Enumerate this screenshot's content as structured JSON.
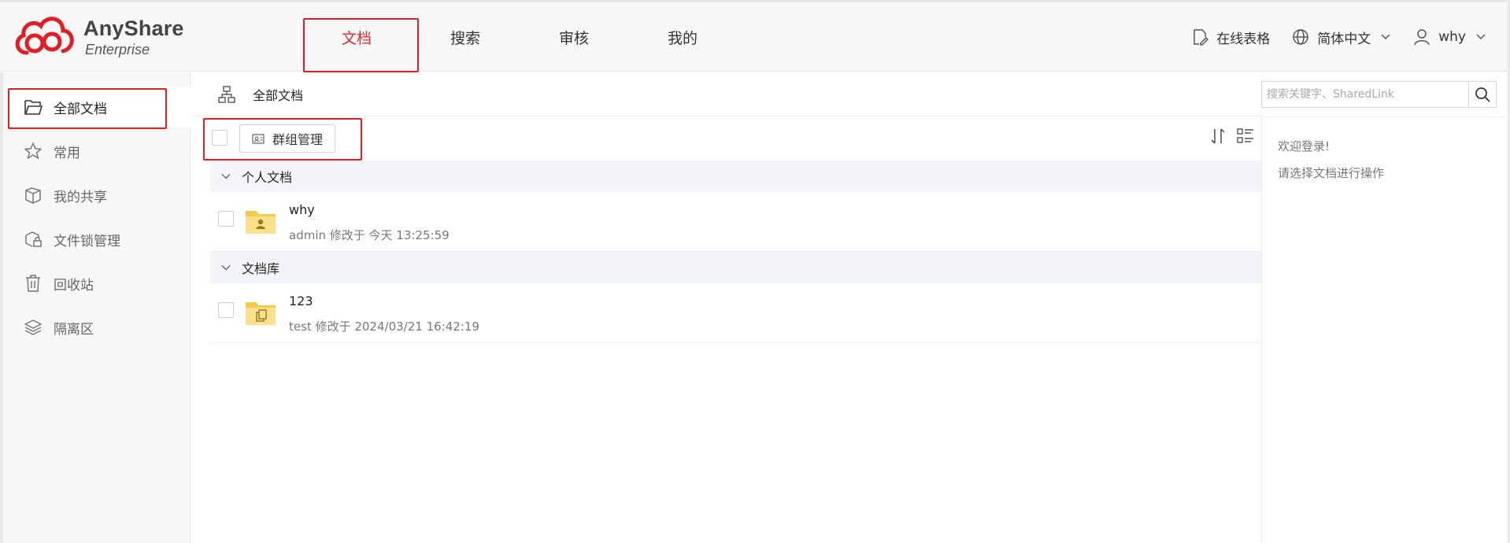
{
  "brand": {
    "name": "AnyShare",
    "subtitle": "Enterprise",
    "accent_color": "#e0282e"
  },
  "nav": {
    "tabs": [
      {
        "label": "文档",
        "active": true
      },
      {
        "label": "搜索",
        "active": false
      },
      {
        "label": "审核",
        "active": false
      },
      {
        "label": "我的",
        "active": false
      }
    ]
  },
  "header": {
    "online_sheet": "在线表格",
    "language": "简体中文",
    "user": "why"
  },
  "sidebar": {
    "items": [
      {
        "label": "全部文档",
        "icon": "folder-open-icon",
        "active": true
      },
      {
        "label": "常用",
        "icon": "star-icon",
        "active": false
      },
      {
        "label": "我的共享",
        "icon": "share-icon",
        "active": false
      },
      {
        "label": "文件锁管理",
        "icon": "file-lock-icon",
        "active": false
      },
      {
        "label": "回收站",
        "icon": "trash-icon",
        "active": false
      },
      {
        "label": "隔离区",
        "icon": "layers-icon",
        "active": false
      }
    ]
  },
  "main": {
    "breadcrumb": "全部文档",
    "group_button": "群组管理",
    "sections": [
      {
        "title": "个人文档",
        "items": [
          {
            "name": "why",
            "meta": "admin 修改于 今天 13:25:59",
            "icon": "personal-folder-icon"
          }
        ]
      },
      {
        "title": "文档库",
        "items": [
          {
            "name": "123",
            "meta": "test 修改于 2024/03/21 16:42:19",
            "icon": "library-folder-icon"
          }
        ]
      }
    ]
  },
  "search": {
    "placeholder": "搜索关键字、SharedLink"
  },
  "right_panel": {
    "welcome": "欢迎登录!",
    "hint": "请选择文档进行操作"
  }
}
